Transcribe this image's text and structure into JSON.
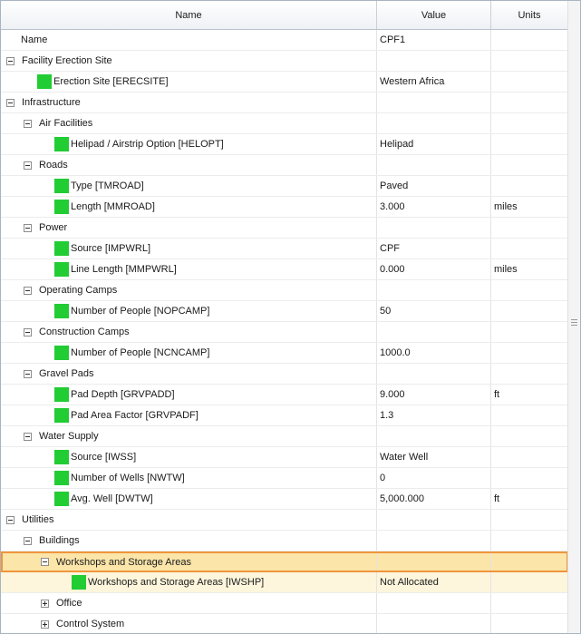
{
  "columns": {
    "name": "Name",
    "value": "Value",
    "units": "Units"
  },
  "swatch_color": "#22cc33",
  "selection_border_color": "#f0953c",
  "rows": [
    {
      "id": "name",
      "label": "Name",
      "value": "CPF1",
      "units": "",
      "level": 0,
      "type": "plain"
    },
    {
      "id": "facility-erection-site",
      "label": "Facility Erection Site",
      "value": "",
      "units": "",
      "level": 0,
      "type": "group",
      "expanded": true
    },
    {
      "id": "erecsite",
      "label": "Erection Site [ERECSITE]",
      "value": "Western Africa",
      "units": "",
      "level": 1,
      "type": "param"
    },
    {
      "id": "infrastructure",
      "label": "Infrastructure",
      "value": "",
      "units": "",
      "level": 0,
      "type": "group",
      "expanded": true
    },
    {
      "id": "air-facilities",
      "label": "Air Facilities",
      "value": "",
      "units": "",
      "level": 1,
      "type": "group",
      "expanded": true
    },
    {
      "id": "helopt",
      "label": "Helipad / Airstrip Option [HELOPT]",
      "value": "Helipad",
      "units": "",
      "level": 2,
      "type": "param"
    },
    {
      "id": "roads",
      "label": "Roads",
      "value": "",
      "units": "",
      "level": 1,
      "type": "group",
      "expanded": true
    },
    {
      "id": "tmroad",
      "label": "Type [TMROAD]",
      "value": "Paved",
      "units": "",
      "level": 2,
      "type": "param"
    },
    {
      "id": "mmroad",
      "label": "Length [MMROAD]",
      "value": "3.000",
      "units": "miles",
      "level": 2,
      "type": "param"
    },
    {
      "id": "power",
      "label": "Power",
      "value": "",
      "units": "",
      "level": 1,
      "type": "group",
      "expanded": true
    },
    {
      "id": "impwrl",
      "label": "Source [IMPWRL]",
      "value": "CPF",
      "units": "",
      "level": 2,
      "type": "param"
    },
    {
      "id": "mmpwrl",
      "label": "Line Length [MMPWRL]",
      "value": "0.000",
      "units": "miles",
      "level": 2,
      "type": "param"
    },
    {
      "id": "operating-camps",
      "label": "Operating Camps",
      "value": "",
      "units": "",
      "level": 1,
      "type": "group",
      "expanded": true
    },
    {
      "id": "nopcamp",
      "label": "Number of People [NOPCAMP]",
      "value": "50",
      "units": "",
      "level": 2,
      "type": "param"
    },
    {
      "id": "construction-camps",
      "label": "Construction Camps",
      "value": "",
      "units": "",
      "level": 1,
      "type": "group",
      "expanded": true
    },
    {
      "id": "ncncamp",
      "label": "Number of People [NCNCAMP]",
      "value": "1000.0",
      "units": "",
      "level": 2,
      "type": "param"
    },
    {
      "id": "gravel-pads",
      "label": "Gravel Pads",
      "value": "",
      "units": "",
      "level": 1,
      "type": "group",
      "expanded": true
    },
    {
      "id": "grvpadd",
      "label": "Pad Depth [GRVPADD]",
      "value": "9.000",
      "units": "ft",
      "level": 2,
      "type": "param"
    },
    {
      "id": "grvpadf",
      "label": "Pad Area Factor [GRVPADF]",
      "value": "1.3",
      "units": "",
      "level": 2,
      "type": "param"
    },
    {
      "id": "water-supply",
      "label": "Water Supply",
      "value": "",
      "units": "",
      "level": 1,
      "type": "group",
      "expanded": true
    },
    {
      "id": "iwss",
      "label": "Source [IWSS]",
      "value": "Water Well",
      "units": "",
      "level": 2,
      "type": "param"
    },
    {
      "id": "nwtw",
      "label": "Number of Wells [NWTW]",
      "value": "0",
      "units": "",
      "level": 2,
      "type": "param"
    },
    {
      "id": "dwtw",
      "label": "Avg. Well [DWTW]",
      "value": "5,000.000",
      "units": "ft",
      "level": 2,
      "type": "param"
    },
    {
      "id": "utilities",
      "label": "Utilities",
      "value": "",
      "units": "",
      "level": 0,
      "type": "group",
      "expanded": true
    },
    {
      "id": "buildings",
      "label": "Buildings",
      "value": "",
      "units": "",
      "level": 1,
      "type": "group",
      "expanded": true
    },
    {
      "id": "workshops",
      "label": "Workshops and Storage Areas",
      "value": "",
      "units": "",
      "level": 2,
      "type": "group",
      "expanded": true,
      "state": "selected"
    },
    {
      "id": "iwshp",
      "label": "Workshops and Storage Areas [IWSHP]",
      "value": "Not Allocated",
      "units": "",
      "level": 3,
      "type": "param",
      "state": "selected-child"
    },
    {
      "id": "office",
      "label": "Office",
      "value": "",
      "units": "",
      "level": 2,
      "type": "group",
      "expanded": false
    },
    {
      "id": "control-system",
      "label": "Control System",
      "value": "",
      "units": "",
      "level": 2,
      "type": "group",
      "expanded": false
    }
  ]
}
